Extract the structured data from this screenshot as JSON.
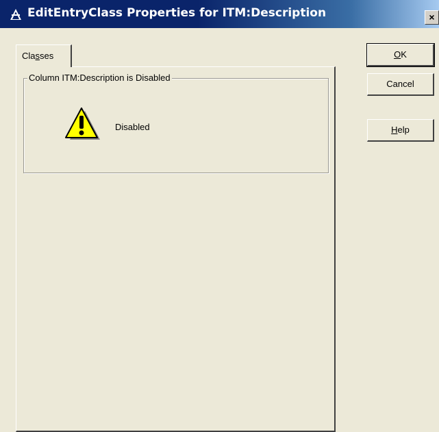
{
  "window": {
    "title": "EditEntryClass Properties for ITM:Description",
    "icon": "app-icon",
    "close_label": "×"
  },
  "tabs": [
    {
      "label_pre": "Cla",
      "label_mnemonic": "s",
      "label_post": "ses",
      "selected": true
    }
  ],
  "group": {
    "legend": "Column ITM:Description is Disabled",
    "icon": "warning-icon",
    "status_text": "Disabled"
  },
  "buttons": {
    "ok": {
      "mnemonic": "O",
      "rest": "K"
    },
    "cancel": {
      "label": "Cancel"
    },
    "help": {
      "mnemonic": "H",
      "rest": "elp"
    }
  },
  "colors": {
    "titlebar_start": "#0a246a",
    "titlebar_end": "#a6caf0",
    "face": "#ece9d8",
    "warning": "#ffff00"
  }
}
